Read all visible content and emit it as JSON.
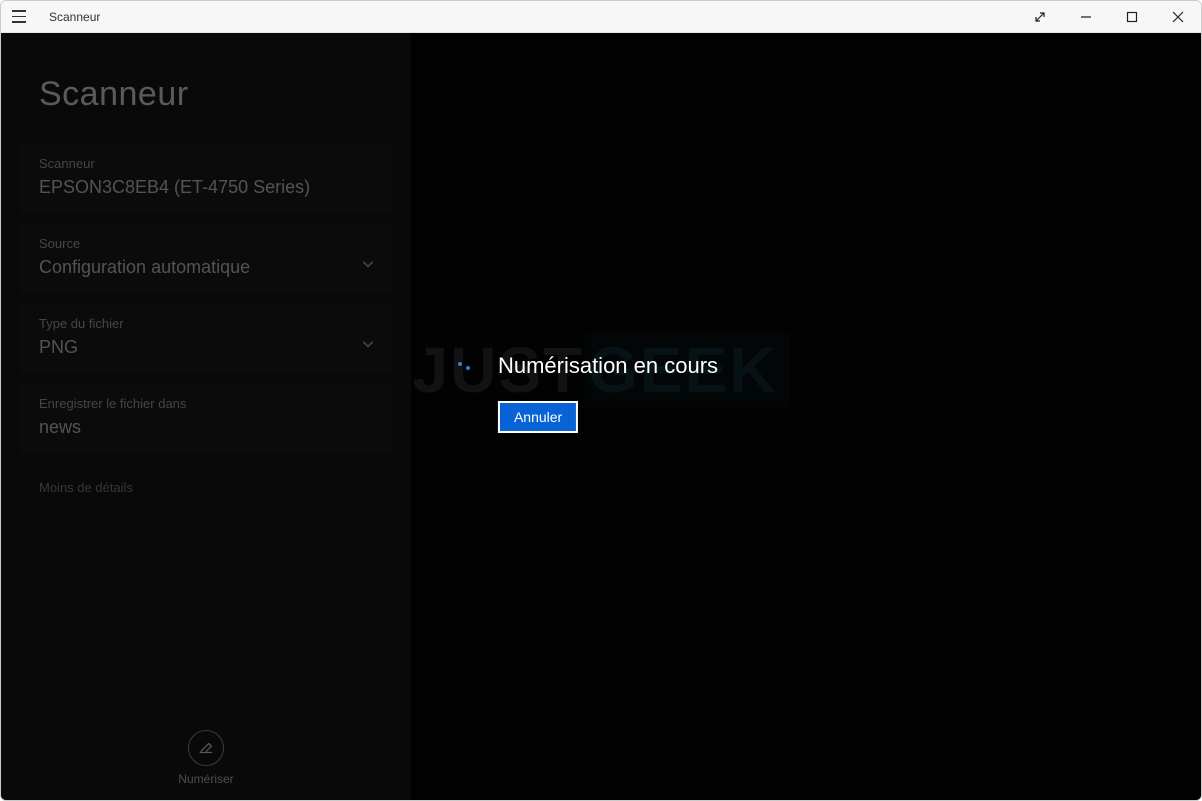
{
  "window": {
    "title": "Scanneur"
  },
  "sidebar": {
    "heading": "Scanneur",
    "scanner": {
      "label": "Scanneur",
      "value": "EPSON3C8EB4 (ET-4750 Series)"
    },
    "source": {
      "label": "Source",
      "value": "Configuration automatique"
    },
    "filetype": {
      "label": "Type du fichier",
      "value": "PNG"
    },
    "saveto": {
      "label": "Enregistrer le fichier dans",
      "value": "news"
    },
    "details_link": "Moins de détails",
    "scan_button": "Numériser"
  },
  "overlay": {
    "status": "Numérisation en cours",
    "cancel": "Annuler"
  },
  "watermark": {
    "part1": "JUST",
    "part2": "GEEK"
  }
}
